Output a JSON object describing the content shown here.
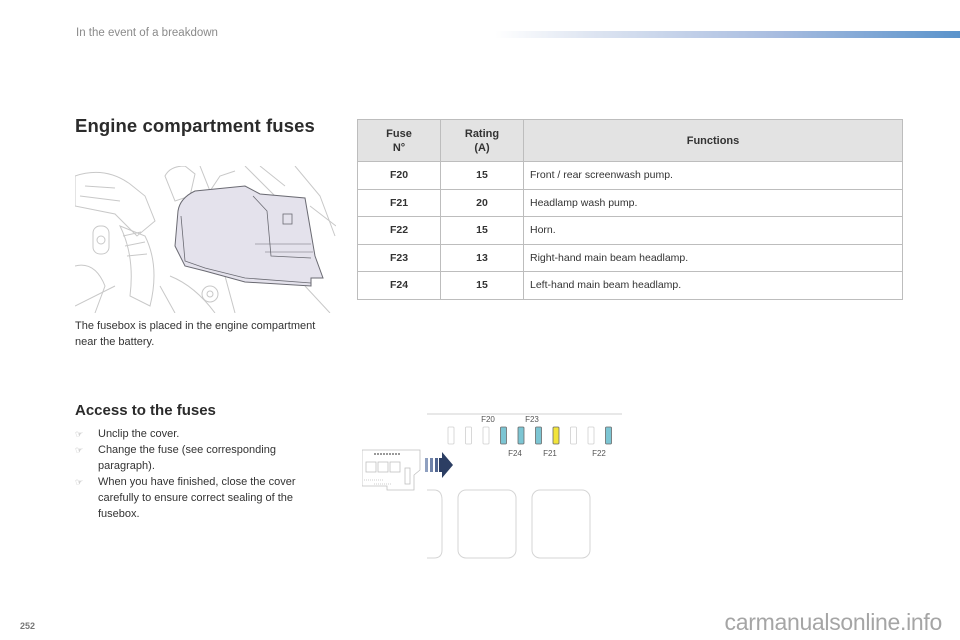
{
  "header": {
    "section": "In the event of a breakdown"
  },
  "title": "Engine compartment fuses",
  "illustration": {
    "name": "engine-compartment-fusebox-illustration",
    "caption": "The fusebox is placed in the engine compartment near the battery."
  },
  "access": {
    "title": "Access to the fuses",
    "bullet_icon": "pointing-hand-icon",
    "bullet_glyph": "☞",
    "steps": [
      "Unclip the cover.",
      "Change the fuse (see corresponding paragraph).",
      "When you have finished, close the cover carefully to ensure correct sealing of the fusebox."
    ]
  },
  "table": {
    "headers": {
      "fuse_line1": "Fuse",
      "fuse_line2": "N°",
      "rating_line1": "Rating",
      "rating_line2": "(A)",
      "functions": "Functions"
    },
    "rows": [
      {
        "fuse": "F20",
        "rating": "15",
        "function": "Front / rear screenwash pump."
      },
      {
        "fuse": "F21",
        "rating": "20",
        "function": "Headlamp wash pump."
      },
      {
        "fuse": "F22",
        "rating": "15",
        "function": "Horn."
      },
      {
        "fuse": "F23",
        "rating": "13",
        "function": "Right-hand main beam headlamp."
      },
      {
        "fuse": "F24",
        "rating": "15",
        "function": "Left-hand main beam headlamp."
      }
    ]
  },
  "diagram": {
    "labels_top": [
      "F20",
      "F23"
    ],
    "labels_bottom": [
      "F24",
      "F21",
      "F22"
    ],
    "colors": {
      "blue_fuse": "#7cc5d3",
      "yellow_fuse": "#f2e43a",
      "arrow": "#2c3e63",
      "outline": "#cfcfcf"
    }
  },
  "footer": {
    "page_number": "252",
    "watermark": "carmanualsonline.info"
  }
}
